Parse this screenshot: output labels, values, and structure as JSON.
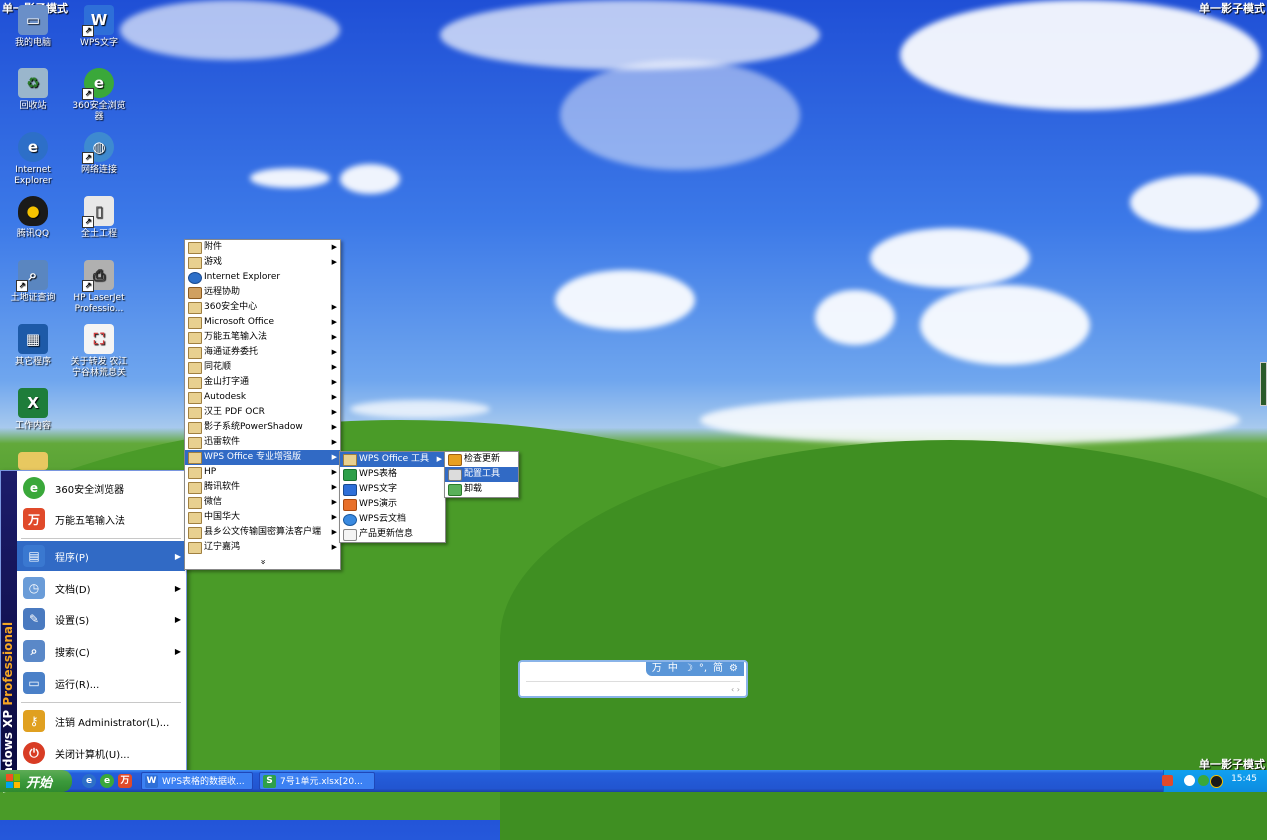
{
  "corner_labels": [
    "单一影子模式",
    "单一影子模式",
    "单一影子模式"
  ],
  "desktop_icons": [
    {
      "label": "我的电脑",
      "color": "#6a8fc8"
    },
    {
      "label": "WPS文字",
      "color": "#2e6fd8"
    },
    {
      "label": "回收站",
      "color": "#9ab6cc"
    },
    {
      "label": "360安全浏览器",
      "color": "#3aa83a"
    },
    {
      "label": "Internet Explorer",
      "color": "#2d6fc8"
    },
    {
      "label": "网络连接",
      "color": "#3e8ad0"
    },
    {
      "label": "腾讯QQ",
      "color": "#1a1a1a"
    },
    {
      "label": "全土工程",
      "color": "#e8e8e8"
    },
    {
      "label": "土地证查询",
      "color": "#5a86c0"
    },
    {
      "label": "HP LaserJet Professio...",
      "color": "#b0b0b0"
    },
    {
      "label": "其它程序",
      "color": "#1d5aa8"
    },
    {
      "label": "关于转发 农江宁谷林荒息关",
      "color": "#d04040"
    },
    {
      "label": "工作内容",
      "color": "#1e7d3a"
    }
  ],
  "start_menu": {
    "side_label_prefix": "Windows XP",
    "side_label_suffix": " Professional",
    "pinned": [
      {
        "label": "360安全浏览器",
        "color": "#3aa83a",
        "glyph": "e"
      },
      {
        "label": "万能五笔输入法",
        "color": "#e04a2a",
        "glyph": "万"
      }
    ],
    "items": [
      {
        "label": "程序(P)",
        "color": "#3a78d0",
        "glyph": "▤",
        "arrow": "▶"
      },
      {
        "label": "文档(D)",
        "color": "#6a9cd8",
        "glyph": "◷",
        "arrow": "▶"
      },
      {
        "label": "设置(S)",
        "color": "#4a7ac0",
        "glyph": "✎",
        "arrow": "▶"
      },
      {
        "label": "搜索(C)",
        "color": "#5a88c8",
        "glyph": "⌕",
        "arrow": "▶"
      },
      {
        "label": "运行(R)...",
        "color": "#4a80c8",
        "glyph": "▭",
        "arrow": ""
      },
      {
        "label": "注销 Administrator(L)...",
        "color": "#e0a020",
        "glyph": "⚷",
        "arrow": ""
      },
      {
        "label": "关闭计算机(U)...",
        "color": "#d83c24",
        "glyph": "⏻",
        "arrow": ""
      }
    ]
  },
  "programs_menu": [
    {
      "label": "附件",
      "arrow": true
    },
    {
      "label": "游戏",
      "arrow": true
    },
    {
      "label": "Internet Explorer",
      "arrow": false
    },
    {
      "label": "远程协助",
      "arrow": false
    },
    {
      "label": "360安全中心",
      "arrow": true
    },
    {
      "label": "Microsoft Office",
      "arrow": true
    },
    {
      "label": "万能五笔输入法",
      "arrow": true
    },
    {
      "label": "海通证券委托",
      "arrow": true
    },
    {
      "label": "同花顺",
      "arrow": true
    },
    {
      "label": "金山打字通",
      "arrow": true
    },
    {
      "label": "Autodesk",
      "arrow": true
    },
    {
      "label": "汉王 PDF OCR",
      "arrow": true
    },
    {
      "label": "影子系统PowerShadow",
      "arrow": true
    },
    {
      "label": "迅雷软件",
      "arrow": true
    },
    {
      "label": "WPS Office 专业增强版",
      "arrow": true,
      "highlight": true
    },
    {
      "label": "HP",
      "arrow": true
    },
    {
      "label": "腾讯软件",
      "arrow": true
    },
    {
      "label": "微信",
      "arrow": true
    },
    {
      "label": "中国华大",
      "arrow": true
    },
    {
      "label": "县乡公文传输国密算法客户端",
      "arrow": true
    },
    {
      "label": "辽宁嘉鸿",
      "arrow": true
    }
  ],
  "programs_more": "»",
  "wps_menu": [
    {
      "label": "WPS Office 工具",
      "arrow": true,
      "highlight": true
    },
    {
      "label": "WPS表格",
      "arrow": false
    },
    {
      "label": "WPS文字",
      "arrow": false
    },
    {
      "label": "WPS演示",
      "arrow": false
    },
    {
      "label": "WPS云文档",
      "arrow": false
    },
    {
      "label": "产品更新信息",
      "arrow": false
    }
  ],
  "tools_menu": [
    {
      "label": "检查更新",
      "highlight": false
    },
    {
      "label": "配置工具",
      "highlight": true
    },
    {
      "label": "卸载",
      "highlight": false
    }
  ],
  "ime_bar": {
    "icons": [
      "万",
      "中",
      "☽",
      "°,",
      "简",
      "⚙"
    ],
    "nav": "‹ ›"
  },
  "taskbar": {
    "start_label": "开始",
    "quick_launch": [
      "e",
      "e",
      "万"
    ],
    "buttons": [
      {
        "label": "WPS表格的数据收...",
        "icon": "W",
        "color": "#2e6fd8"
      },
      {
        "label": "7号1单元.xlsx[20...",
        "icon": "S",
        "color": "#2ea04a"
      }
    ],
    "clock": "15:45"
  }
}
